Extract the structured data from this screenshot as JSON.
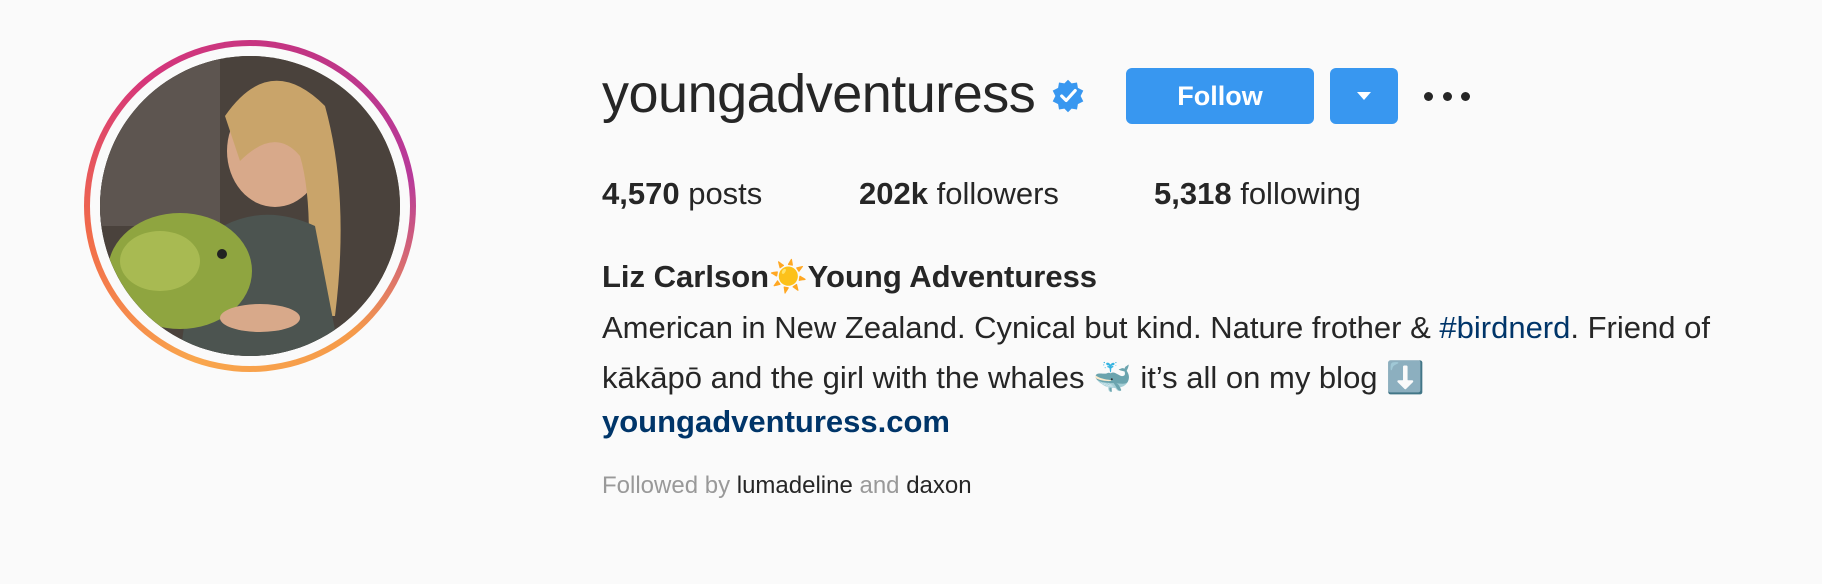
{
  "profile": {
    "username": "youngadventuress",
    "verified": true,
    "follow_label": "Follow",
    "stats": [
      {
        "count": "4,570",
        "label": "posts"
      },
      {
        "count": "202k",
        "label": "followers"
      },
      {
        "count": "5,318",
        "label": "following"
      }
    ],
    "full_name": "Liz Carlson☀️Young Adventuress",
    "bio_line1_pre": "American in New Zealand. Cynical but kind. Nature frother & ",
    "bio_hashtag": "#birdnerd",
    "bio_line1_post": ". Friend of",
    "bio_line2": "kākāpō and the girl with the whales 🐳 it’s all on my blog ⬇️",
    "website": "youngadventuress.com",
    "followed_by_prefix": "Followed by",
    "followed_by_user1": "lumadeline",
    "followed_by_and": "and",
    "followed_by_user2": "daxon"
  },
  "colors": {
    "accent": "#3897f0",
    "link": "#003569",
    "verified": "#3897f0",
    "story_ring": [
      "#f9a64d",
      "#c13584"
    ]
  },
  "icons": [
    "verified-badge-icon",
    "chevron-down-icon",
    "more-options-icon"
  ]
}
